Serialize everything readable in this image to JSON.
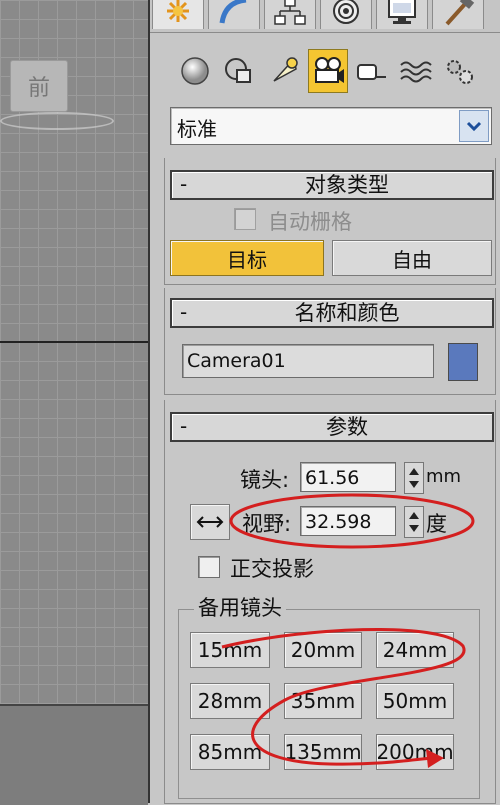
{
  "viewport": {
    "viewcube_label": "前"
  },
  "command_panel": {
    "tabs": [
      {
        "name": "create",
        "icon": "star-burst-icon"
      },
      {
        "name": "modify",
        "icon": "modify-arc-icon"
      },
      {
        "name": "hierarchy",
        "icon": "hierarchy-icon"
      },
      {
        "name": "motion",
        "icon": "motion-icon"
      },
      {
        "name": "display",
        "icon": "display-monitor-icon"
      },
      {
        "name": "utilities",
        "icon": "hammer-icon"
      }
    ],
    "categories": [
      {
        "name": "geometry",
        "icon": "sphere-icon"
      },
      {
        "name": "shapes",
        "icon": "shapes-icon"
      },
      {
        "name": "lights",
        "icon": "light-icon"
      },
      {
        "name": "cameras",
        "icon": "camera-icon",
        "active": true
      },
      {
        "name": "helpers",
        "icon": "tape-helper-icon"
      },
      {
        "name": "space-warps",
        "icon": "waves-icon"
      },
      {
        "name": "systems",
        "icon": "gears-icon"
      }
    ],
    "type_dropdown": {
      "value": "标准"
    },
    "object_type": {
      "title": "对象类型",
      "collapse_symbol": "-",
      "autogrid_label": "自动栅格",
      "buttons": [
        "目标",
        "自由"
      ],
      "selected": "目标"
    },
    "name_color": {
      "title": "名称和颜色",
      "collapse_symbol": "-",
      "name_value": "Camera01",
      "color": "#5a79bd"
    },
    "parameters": {
      "title": "参数",
      "collapse_symbol": "-",
      "lens_label": "镜头:",
      "lens_value": "61.56",
      "lens_unit": "mm",
      "fov_label": "视野:",
      "fov_value": "32.598",
      "fov_unit": "度",
      "orthographic_label": "正交投影",
      "stock_lenses_title": "备用镜头",
      "stock_lenses": [
        "15mm",
        "20mm",
        "24mm",
        "28mm",
        "35mm",
        "50mm",
        "85mm",
        "135mm",
        "200mm"
      ]
    }
  },
  "annotation_color": "#d41f1f"
}
